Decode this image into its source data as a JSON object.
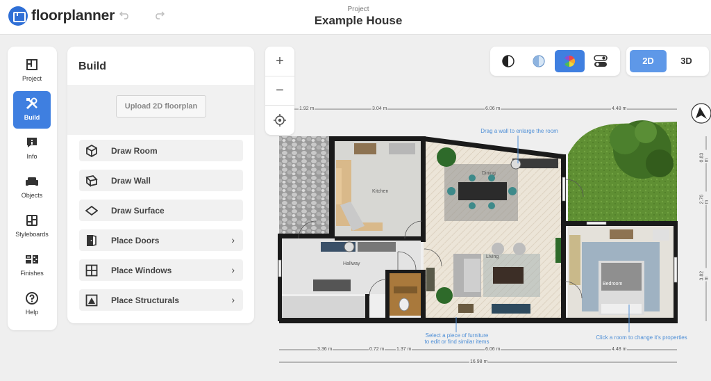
{
  "app": {
    "logo_text": "floorplanner"
  },
  "header": {
    "project_label": "Project",
    "project_name": "Example House",
    "undo_icon": "undo-icon",
    "redo_icon": "redo-icon"
  },
  "sidenav": {
    "items": [
      {
        "label": "Project",
        "icon": "floorplan-icon",
        "active": false
      },
      {
        "label": "Build",
        "icon": "tools-icon",
        "active": true
      },
      {
        "label": "Info",
        "icon": "info-icon",
        "active": false
      },
      {
        "label": "Objects",
        "icon": "sofa-icon",
        "active": false
      },
      {
        "label": "Styleboards",
        "icon": "styleboard-icon",
        "active": false
      },
      {
        "label": "Finishes",
        "icon": "finishes-icon",
        "active": false
      },
      {
        "label": "Help",
        "icon": "help-icon",
        "active": false
      }
    ]
  },
  "build_panel": {
    "title": "Build",
    "upload_label": "Upload 2D floorplan",
    "tools": [
      {
        "label": "Draw Room",
        "icon": "cube-icon",
        "has_submenu": false
      },
      {
        "label": "Draw Wall",
        "icon": "wall-icon",
        "has_submenu": false
      },
      {
        "label": "Draw Surface",
        "icon": "surface-icon",
        "has_submenu": false
      },
      {
        "label": "Place Doors",
        "icon": "door-icon",
        "has_submenu": true
      },
      {
        "label": "Place Windows",
        "icon": "window-icon",
        "has_submenu": true
      },
      {
        "label": "Place Structurals",
        "icon": "structural-icon",
        "has_submenu": true
      }
    ],
    "chevron": "›"
  },
  "zoom": {
    "zoom_in": "+",
    "zoom_out": "−",
    "locate_icon": "locate-icon"
  },
  "view_modes": [
    {
      "icon": "contrast-icon",
      "active": false
    },
    {
      "icon": "half-circle-icon",
      "active": false
    },
    {
      "icon": "color-wheel-icon",
      "active": true
    },
    {
      "icon": "toggle-icon",
      "active": false
    }
  ],
  "dimension_toggle": {
    "options": [
      "2D",
      "3D"
    ],
    "selected": "2D"
  },
  "canvas": {
    "dims_top": [
      "1.92 m",
      "3.04 m",
      "6.06 m",
      "4.48 m"
    ],
    "dims_bottom": [
      "3.36 m",
      "0.72 m",
      "1.37 m",
      "6.06 m",
      "4.48 m"
    ],
    "dim_total": "16.98 m",
    "dims_right": [
      "0.83 m",
      "2.76 m",
      "3.82 m"
    ],
    "rooms": [
      "Kitchen",
      "Dining",
      "Hallway",
      "Living",
      "Bedroom"
    ],
    "hints": {
      "drag_wall": "Drag a wall to enlarge the room",
      "select_furniture_1": "Select a piece of furniture",
      "select_furniture_2": "to edit or find similar items",
      "click_room": "Click a room to change it's properties"
    },
    "compass": "compass-icon",
    "colors": {
      "accent": "#3f7fe0",
      "wall": "#1a1a1a",
      "floor_wood": "#e9e2d5",
      "floor_stone": "#b8b8b8",
      "grass": "#5c8d2f",
      "hint": "#4d8ed6"
    }
  }
}
